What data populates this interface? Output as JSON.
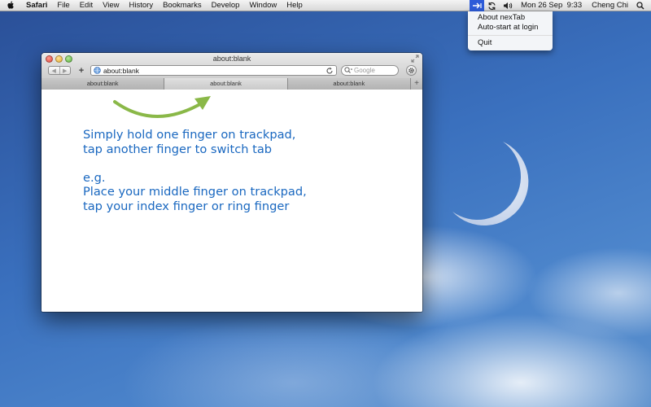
{
  "menubar": {
    "app_name": "Safari",
    "menus": [
      "File",
      "Edit",
      "View",
      "History",
      "Bookmarks",
      "Develop",
      "Window",
      "Help"
    ],
    "clock": "Mon 26 Sep  9:33",
    "user": "Cheng Chi"
  },
  "status_menu": {
    "items": [
      "About nexTab",
      "Auto-start at login",
      "Quit"
    ]
  },
  "browser": {
    "title": "about:blank",
    "address": "about:blank",
    "search_placeholder": "Google",
    "tabs": [
      {
        "label": "about:blank",
        "active": false
      },
      {
        "label": "about:blank",
        "active": true
      },
      {
        "label": "about:blank",
        "active": false
      }
    ],
    "new_tab_label": "+",
    "add_bookmark_label": "+"
  },
  "instructions": {
    "line1": "Simply hold one finger on trackpad,",
    "line2": "tap another finger to switch tab",
    "line3": "e.g.",
    "line4": "Place your middle finger on trackpad,",
    "line5": "tap your index finger or ring finger"
  },
  "colors": {
    "instruction_text": "#1a68c0",
    "arrow": "#8ab848",
    "status_icon_bg": "#2d5bd8"
  }
}
